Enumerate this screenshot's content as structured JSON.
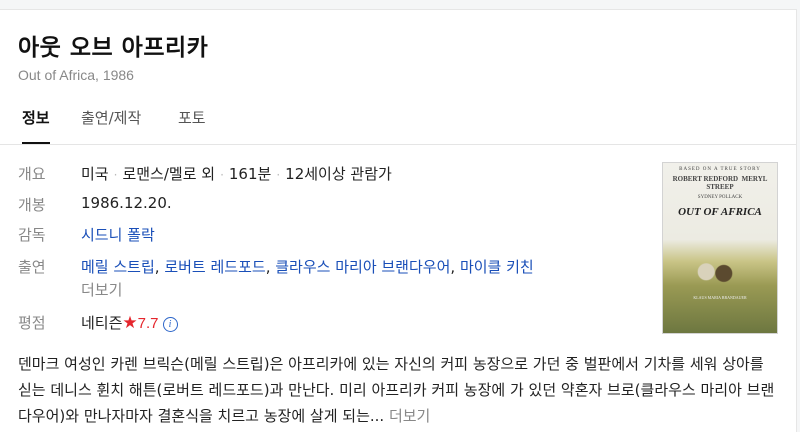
{
  "title": "아웃 오브 아프리카",
  "subtitle": "Out of Africa, 1986",
  "tabs": [
    {
      "label": "정보"
    },
    {
      "label": "출연/제작"
    },
    {
      "label": "포토"
    }
  ],
  "info": {
    "overview": {
      "label": "개요",
      "country": "미국",
      "genre": "로맨스/멜로 외",
      "runtime": "161분",
      "rating": "12세이상 관람가"
    },
    "release": {
      "label": "개봉",
      "value": "1986.12.20."
    },
    "director": {
      "label": "감독",
      "value": "시드니 폴락"
    },
    "cast": {
      "label": "출연",
      "actors": [
        "메릴 스트립",
        "로버트 레드포드",
        "클라우스 마리아 브랜다우어",
        "마이클 키친"
      ],
      "more": "더보기"
    },
    "score": {
      "label": "평점",
      "source": "네티즌",
      "star": "★",
      "value": "7.7",
      "info_icon": "i"
    }
  },
  "poster": {
    "top_text": "BASED ON A TRUE STORY",
    "names": [
      "ROBERT REDFORD",
      "MERYL STREEP"
    ],
    "director_text": "SYDNEY POLLACK",
    "title": "OUT OF AFRICA",
    "credit": "KLAUS MARIA BRANDAUER"
  },
  "synopsis": {
    "text": "덴마크 여성인 카렌 브릭슨(메릴 스트립)은 아프리카에 있는 자신의 커피 농장으로 가던 중 벌판에서 기차를 세워 상아를 싣는 데니스 휜치 해튼(로버트 레드포드)과 만난다. 미리 아프리카 커피 농장에 가 있던 약혼자 브로(클라우스 마리아 브랜다우어)와 만나자마자 결혼식을 치르고 농장에 살게 되는... ",
    "more": "더보기"
  },
  "colors": {
    "link": "#1a4fb8",
    "score": "#e5262d",
    "label": "#888888"
  }
}
